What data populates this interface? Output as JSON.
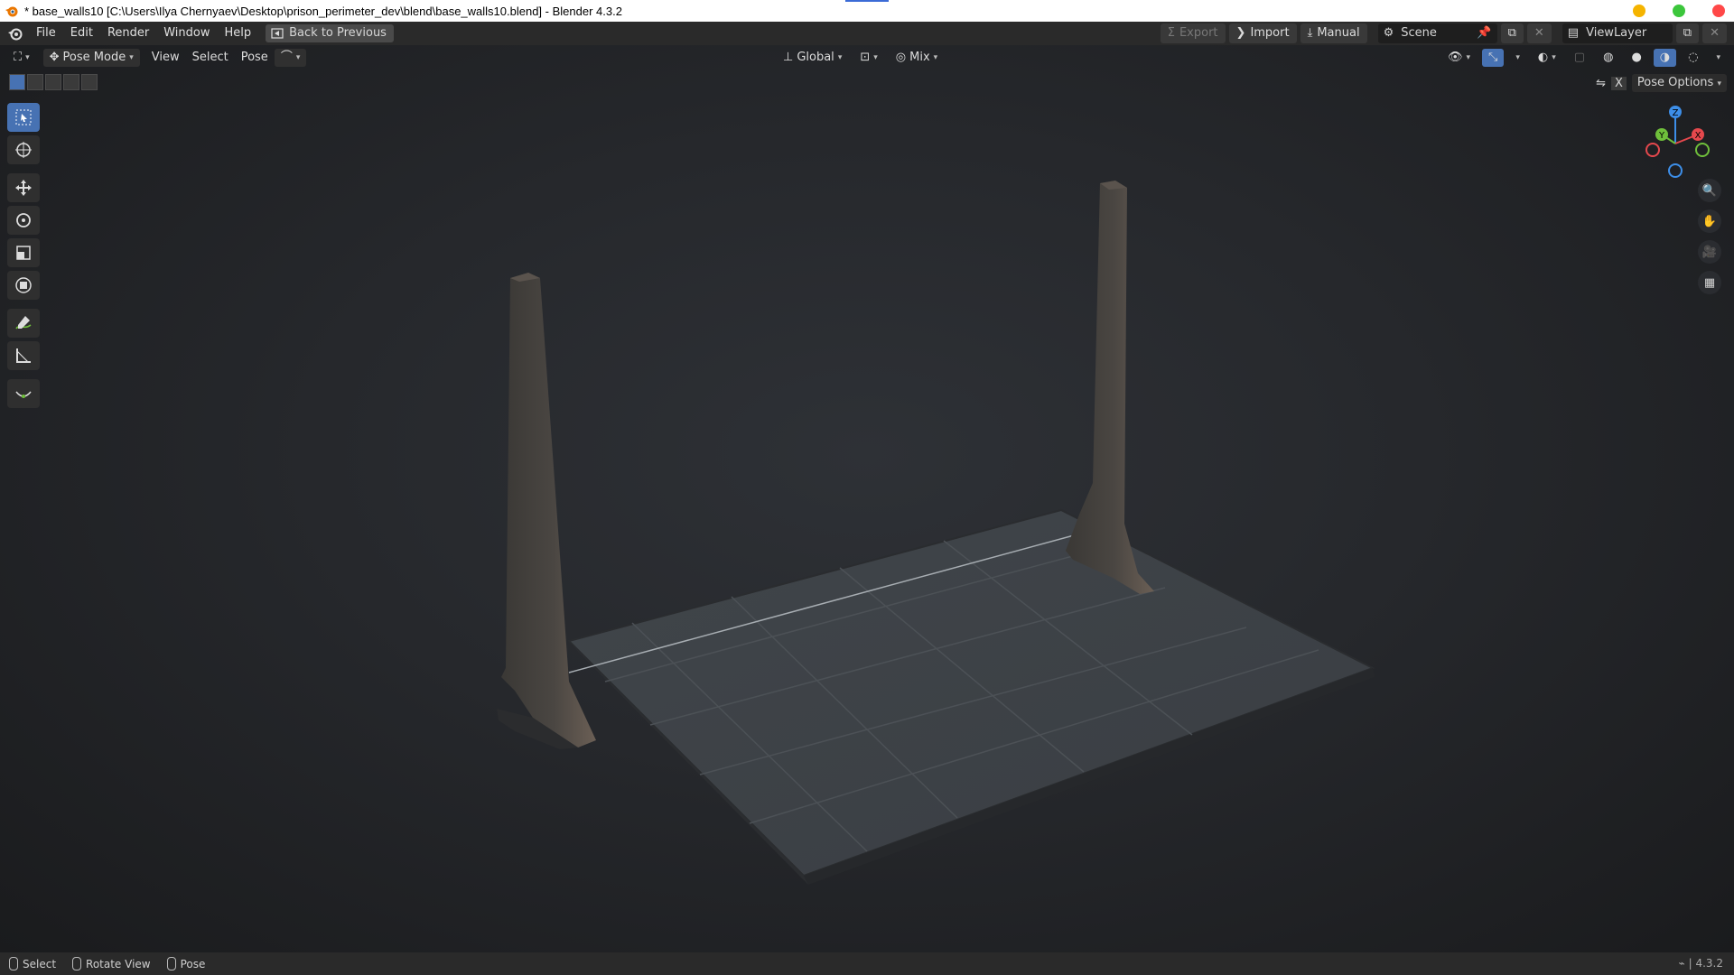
{
  "window": {
    "title": "* base_walls10 [C:\\Users\\Ilya Chernyaev\\Desktop\\prison_perimeter_dev\\blend\\base_walls10.blend] - Blender 4.3.2",
    "controls_colors": {
      "minimize": "#f5b400",
      "maximize": "#3cc63c",
      "close": "#ff4848"
    }
  },
  "menubar": {
    "items": [
      "File",
      "Edit",
      "Render",
      "Window",
      "Help"
    ],
    "back_label": "Back to Previous",
    "export_label": "Export",
    "import_label": "Import",
    "manual_label": "Manual",
    "scene_value": "Scene",
    "viewlayer_value": "ViewLayer"
  },
  "header3d": {
    "mode_label": "Pose Mode",
    "menus": [
      "View",
      "Select",
      "Pose"
    ],
    "orientation_label": "Global",
    "blend_label": "Mix"
  },
  "pose_options_label": "Pose Options",
  "gizmo": {
    "z": "Z",
    "y": "Y",
    "x": "X",
    "colors": {
      "x": "#e5484d",
      "y": "#6fbf3b",
      "z": "#3d8ee8"
    }
  },
  "status": {
    "items": [
      "Select",
      "Rotate View",
      "Pose"
    ],
    "version": "4.3.2"
  },
  "accent_color": "#4772b3"
}
